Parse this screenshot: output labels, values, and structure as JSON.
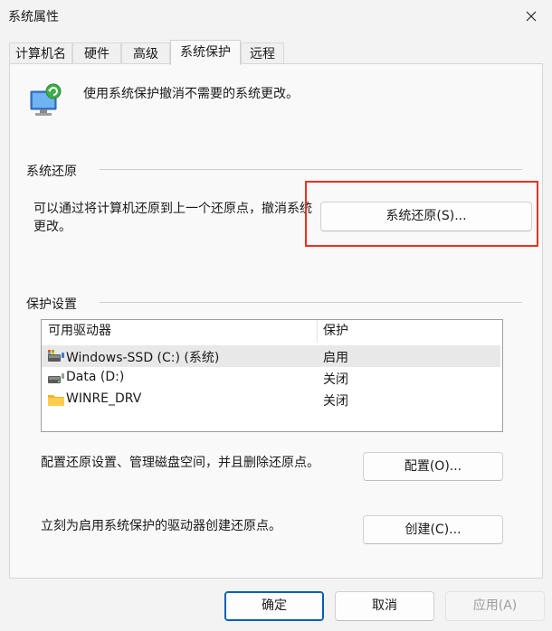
{
  "window": {
    "title": "系统属性"
  },
  "tabs": [
    {
      "label": "计算机名"
    },
    {
      "label": "硬件"
    },
    {
      "label": "高级"
    },
    {
      "label": "系统保护"
    },
    {
      "label": "远程"
    }
  ],
  "intro": {
    "text": "使用系统保护撤消不需要的系统更改。"
  },
  "restore": {
    "group_label": "系统还原",
    "description": "可以通过将计算机还原到上一个还原点，撤消系统更改。",
    "button": "系统还原(S)..."
  },
  "protection": {
    "group_label": "保护设置",
    "columns": [
      "可用驱动器",
      "保护"
    ],
    "drives": [
      {
        "name": "Windows-SSD (C:) (系统)",
        "status": "启用",
        "icon": "system-drive-icon"
      },
      {
        "name": "Data (D:)",
        "status": "关闭",
        "icon": "drive-icon"
      },
      {
        "name": "WINRE_DRV",
        "status": "关闭",
        "icon": "folder-icon"
      }
    ],
    "configure_desc": "配置还原设置、管理磁盘空间，并且删除还原点。",
    "configure_button": "配置(O)...",
    "create_desc": "立刻为启用系统保护的驱动器创建还原点。",
    "create_button": "创建(C)..."
  },
  "footer": {
    "ok": "确定",
    "cancel": "取消",
    "apply": "应用(A)"
  },
  "colors": {
    "accent": "#005fb8",
    "highlight": "#e8321e",
    "background": "#f3f3f3"
  }
}
